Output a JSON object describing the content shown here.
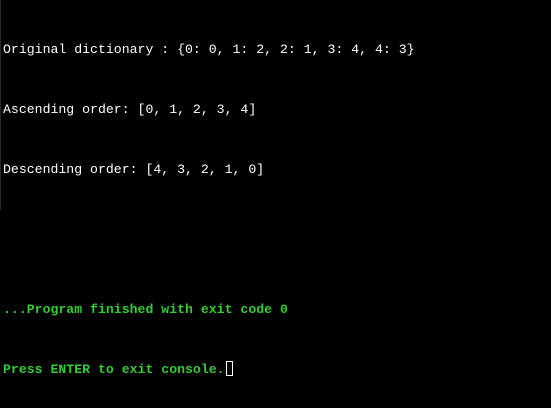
{
  "console": {
    "output_lines": [
      "Original dictionary : {0: 0, 1: 2, 2: 1, 3: 4, 4: 3}",
      "Ascending order: [0, 1, 2, 3, 4]",
      "Descending order: [4, 3, 2, 1, 0]"
    ],
    "exit_message": "...Program finished with exit code 0",
    "prompt": "Press ENTER to exit console."
  },
  "colors": {
    "background": "#000000",
    "text": "#ffffff",
    "status": "#33cc33"
  },
  "icons": {
    "cursor": "block-cursor-icon"
  }
}
